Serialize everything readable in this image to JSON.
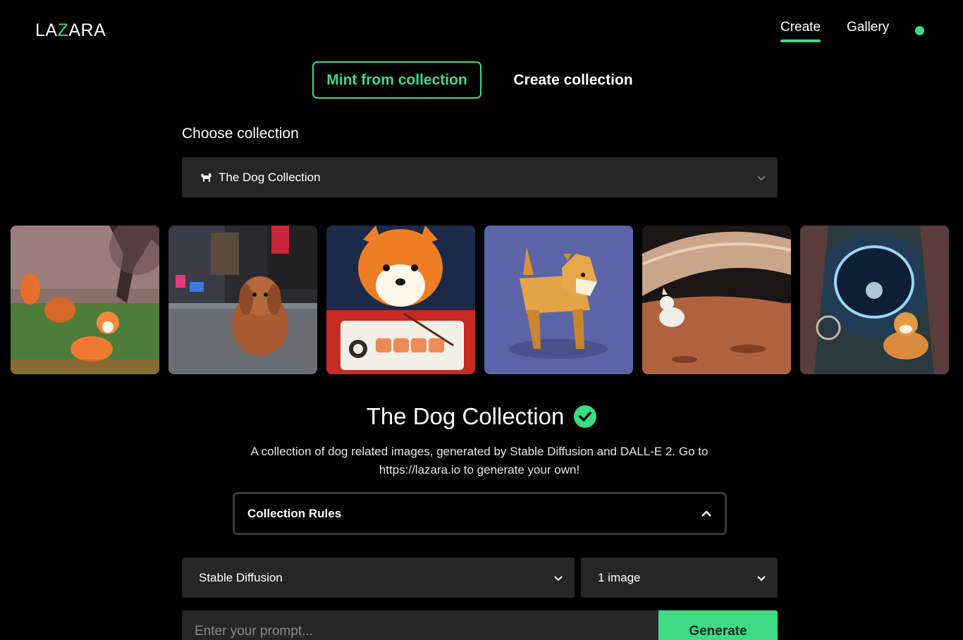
{
  "header": {
    "logo_prefix": "LA",
    "logo_accent": "Z",
    "logo_suffix": "ARA",
    "nav": {
      "create": "Create",
      "gallery": "Gallery"
    }
  },
  "tabs": {
    "mint": "Mint from collection",
    "create": "Create collection"
  },
  "choose": {
    "label": "Choose collection",
    "selected": "The Dog Collection"
  },
  "collection": {
    "title": "The Dog Collection",
    "description": "A collection of dog related images, generated by Stable Diffusion and DALL-E 2. Go to https://lazara.io to generate your own!",
    "rules_label": "Collection Rules"
  },
  "generator": {
    "model": "Stable Diffusion",
    "count": "1 image",
    "prompt_placeholder": "Enter your prompt...",
    "generate_label": "Generate"
  },
  "colors": {
    "accent": "#3ddc84",
    "panel": "#262626",
    "background": "#000000"
  }
}
